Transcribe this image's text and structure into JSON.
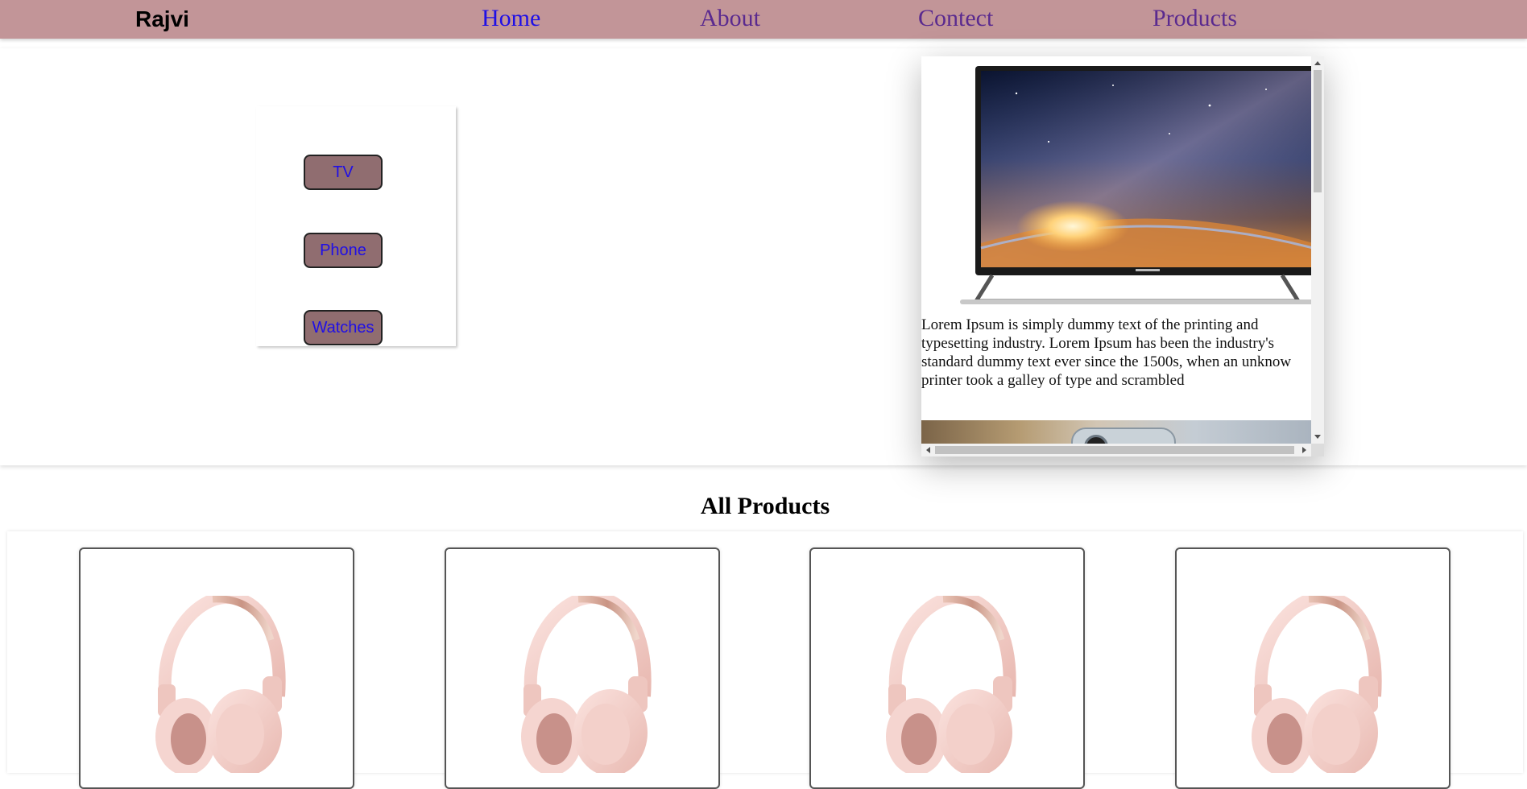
{
  "nav": {
    "brand": "Rajvi",
    "links": [
      {
        "label": "Home",
        "active": true
      },
      {
        "label": "About",
        "active": false
      },
      {
        "label": "Contect",
        "active": false
      },
      {
        "label": "Products",
        "active": false
      }
    ]
  },
  "categories": [
    "TV",
    "Phone",
    "Watches"
  ],
  "preview": {
    "image": "tv-product-image",
    "description_lines": [
      "Lorem Ipsum is simply dummy text of the printing and",
      "typesetting industry. Lorem Ipsum has been the industry's",
      "standard dummy text ever since the 1500s, when an unknow",
      "printer took a galley of type and scrambled"
    ],
    "next_image": "phone-product-image"
  },
  "products_section": {
    "title": "All Products",
    "cards": [
      {
        "image": "headphones-product-image"
      },
      {
        "image": "headphones-product-image"
      },
      {
        "image": "headphones-product-image"
      },
      {
        "image": "headphones-product-image"
      }
    ]
  },
  "colors": {
    "navbar": "#c29598",
    "category_button": "#906d70",
    "active_link": "#1f0fe6",
    "visited_link": "#5a2a8f",
    "headphone_pink": "#f2cfcb"
  }
}
